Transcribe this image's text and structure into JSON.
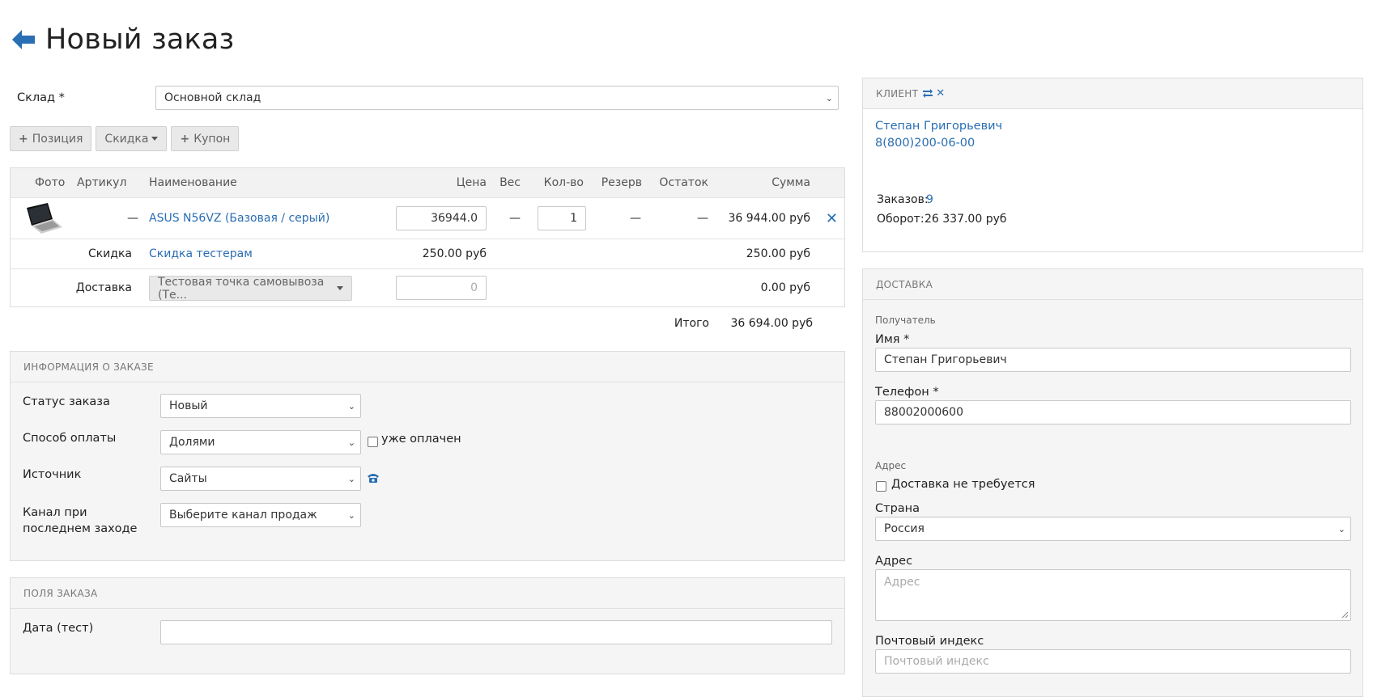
{
  "page": {
    "title": "Новый заказ"
  },
  "warehouse": {
    "label": "Склад *",
    "value": "Основной склад"
  },
  "toolbar": {
    "position_label": "Позиция",
    "discount_label": "Скидка",
    "coupon_label": "Купон"
  },
  "table": {
    "headers": {
      "photo": "Фото",
      "sku": "Артикул",
      "name": "Наименование",
      "price": "Цена",
      "weight": "Вес",
      "qty": "Кол-во",
      "reserve": "Резерв",
      "stock": "Остаток",
      "sum": "Сумма"
    },
    "item": {
      "sku": "—",
      "name": "ASUS N56VZ (Базовая / серый)",
      "price": "36944.0",
      "weight": "—",
      "qty": "1",
      "reserve": "—",
      "stock": "—",
      "sum": "36 944.00 руб"
    },
    "discount": {
      "label": "Скидка",
      "name": "Скидка тестерам",
      "price": "250.00 руб",
      "sum": "250.00 руб"
    },
    "delivery": {
      "label": "Доставка",
      "method": "Тестовая точка самовывоза (Те...",
      "cost_placeholder": "0",
      "sum": "0.00 руб"
    },
    "total": {
      "label": "Итого",
      "value": "36 694.00 руб"
    }
  },
  "order_info": {
    "title": "ИНФОРМАЦИЯ О ЗАКАЗЕ",
    "status": {
      "label": "Статус заказа",
      "value": "Новый"
    },
    "payment": {
      "label": "Способ оплаты",
      "value": "Долями",
      "paid_label": "уже оплачен"
    },
    "source": {
      "label": "Источник",
      "value": "Сайты"
    },
    "channel": {
      "label": "Канал при последнем заходе",
      "value": "Выберите канал продаж"
    }
  },
  "order_fields": {
    "title": "ПОЛЯ ЗАКАЗА",
    "date": {
      "label": "Дата (тест)",
      "value": ""
    }
  },
  "client": {
    "title": "КЛИЕНТ",
    "name": "Степан Григорьевич",
    "phone": "8(800)200-06-00",
    "orders_label": "Заказов:",
    "orders_count": "9",
    "turnover_label": "Оборот:",
    "turnover_value": "26 337.00 руб"
  },
  "delivery_panel": {
    "title": "ДОСТАВКА",
    "recipient_label": "Получатель",
    "name_label": "Имя *",
    "name_value": "Степан Григорьевич",
    "phone_label": "Телефон *",
    "phone_value": "88002000600",
    "address_section_label": "Адрес",
    "no_delivery_label": "Доставка не требуется",
    "country_label": "Страна",
    "country_value": "Россия",
    "address_label": "Адрес",
    "address_placeholder": "Адрес",
    "zip_label": "Почтовый индекс",
    "zip_placeholder": "Почтовый индекс"
  },
  "colors": {
    "accent": "#2a6eb3",
    "panel_bg": "#f5f5f5",
    "border": "#dddddd"
  }
}
